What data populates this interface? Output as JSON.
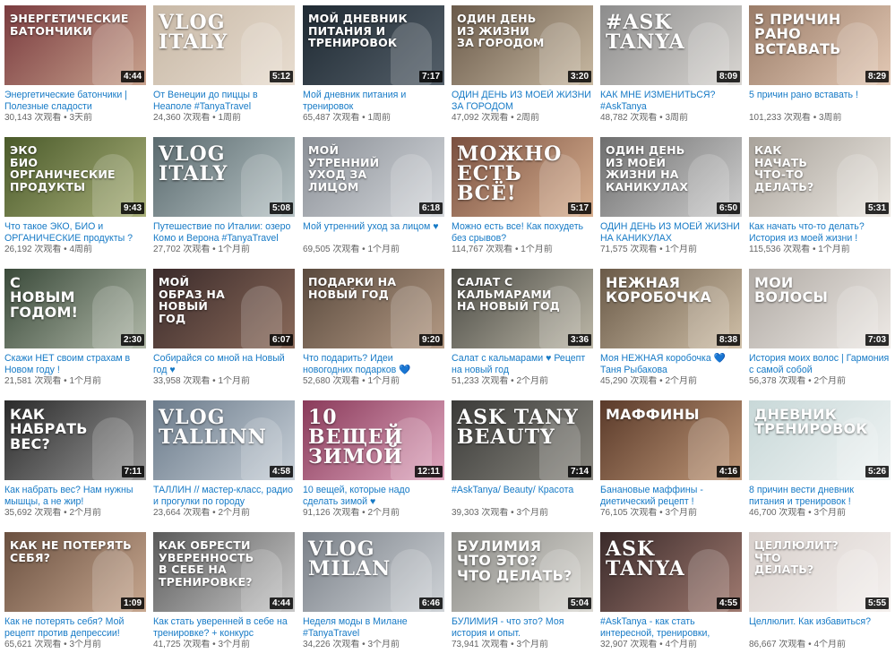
{
  "videos": [
    {
      "title": "Энергетические батончики | Полезные сладости",
      "views": "30,143 次观看",
      "age": "3天前",
      "duration": "4:44",
      "thumb_text": "ЭНЕРГЕТИЧЕСКИЕ\nБАТОНЧИКИ",
      "bg": [
        "#7a3b3f",
        "#c9a38e"
      ]
    },
    {
      "title": "От Венеции до пиццы в Неаполе #TanyaTravel",
      "views": "24,360 次观看",
      "age": "1周前",
      "duration": "5:12",
      "thumb_text": "VLOG\nITALY",
      "bg": [
        "#c7b8a6",
        "#e8ddd0"
      ]
    },
    {
      "title": "Мой дневник питания и тренировок",
      "views": "65,487 次观看",
      "age": "1周前",
      "duration": "7:17",
      "thumb_text": "МОЙ ДНЕВНИК\nПИТАНИЯ И\nТРЕНИРОВОК",
      "bg": [
        "#1f2a33",
        "#55606a"
      ]
    },
    {
      "title": "ОДИН ДЕНЬ ИЗ МОЕЙ ЖИЗНИ ЗА ГОРОДОМ",
      "views": "47,092 次观看",
      "age": "2周前",
      "duration": "3:20",
      "thumb_text": "ОДИН ДЕНЬ\nИЗ ЖИЗНИ\nЗА ГОРОДОМ",
      "bg": [
        "#6a5a4a",
        "#c8b9a2"
      ]
    },
    {
      "title": "КАК МНЕ ИЗМЕНИТЬСЯ? #AskTanya",
      "views": "48,782 次观看",
      "age": "3周前",
      "duration": "8:09",
      "thumb_text": "#ASK\nTANYA",
      "bg": [
        "#8c8c8c",
        "#d9d6d2"
      ]
    },
    {
      "title": "5 причин рано вставать !",
      "views": "101,233 次观看",
      "age": "3周前",
      "duration": "8:29",
      "thumb_text": "5 ПРИЧИН\nРАНО ВСТАВАТЬ",
      "bg": [
        "#9a7c68",
        "#e3c9b5"
      ]
    },
    {
      "title": "Что такое ЭКО, БИО и ОРГАНИЧЕСКИЕ продукты ?",
      "views": "26,192 次观看",
      "age": "4周前",
      "duration": "9:43",
      "thumb_text": "ЭКО\nБИО\nОРГАНИЧЕСКИЕ\nПРОДУКТЫ",
      "bg": [
        "#4a5a2a",
        "#a9b07a"
      ]
    },
    {
      "title": "Путешествие по Италии: озеро Комо и Верона #TanyaTravel",
      "views": "27,702 次观看",
      "age": "1个月前",
      "duration": "5:08",
      "thumb_text": "VLOG\nITALY",
      "bg": [
        "#5a6a6e",
        "#b8c4c6"
      ]
    },
    {
      "title": "Мой утренний уход за лицом ♥",
      "views": "69,505 次观看",
      "age": "1个月前",
      "duration": "6:18",
      "thumb_text": "МОЙ\nУТРЕННИЙ\nУХОД ЗА\nЛИЦОМ",
      "bg": [
        "#8a8f96",
        "#d5d8dc"
      ]
    },
    {
      "title": "Можно есть все! Как похудеть без срывов?",
      "views": "114,767 次观看",
      "age": "1个月前",
      "duration": "5:17",
      "thumb_text": "МОЖНО\nЕСТЬ\nВСЁ!",
      "bg": [
        "#7a5040",
        "#d8b090"
      ]
    },
    {
      "title": "ОДИН ДЕНЬ ИЗ МОЕЙ ЖИЗНИ НА КАНИКУЛАХ",
      "views": "71,575 次观看",
      "age": "1个月前",
      "duration": "6:50",
      "thumb_text": "ОДИН ДЕНЬ\nИЗ МОЕЙ\nЖИЗНИ НА\nКАНИКУЛАХ",
      "bg": [
        "#6e6e6e",
        "#cfcfcf"
      ]
    },
    {
      "title": "Как начать что-то делать? История из моей жизни !",
      "views": "115,536 次观看",
      "age": "1个月前",
      "duration": "5:31",
      "thumb_text": "КАК\nНАЧАТЬ\nЧТО-ТО\nДЕЛАТЬ?",
      "bg": [
        "#a8a29a",
        "#ece8e2"
      ]
    },
    {
      "title": "Скажи НЕТ своим страхам в Новом году !",
      "views": "21,581 次观看",
      "age": "1个月前",
      "duration": "2:30",
      "thumb_text": "С\nНОВЫМ\nГОДОМ!",
      "bg": [
        "#3a4a3a",
        "#b0b8a8"
      ]
    },
    {
      "title": "Собирайся со мной на Новый год ♥",
      "views": "33,958 次观看",
      "age": "1个月前",
      "duration": "6:07",
      "thumb_text": "МОЙ\nОБРАЗ НА\nНОВЫЙ\nГОД",
      "bg": [
        "#3a2a2a",
        "#8a6a5a"
      ]
    },
    {
      "title": "Что подарить? Идеи новогодних подарков 💙",
      "views": "52,680 次观看",
      "age": "1个月前",
      "duration": "9:20",
      "thumb_text": "ПОДАРКИ НА\nНОВЫЙ ГОД",
      "bg": [
        "#5a4a3e",
        "#b49a84"
      ]
    },
    {
      "title": "Салат с кальмарами ♥ Рецепт на новый год",
      "views": "51,233 次观看",
      "age": "2个月前",
      "duration": "3:36",
      "thumb_text": "САЛАТ С КАЛЬМАРАМИ\nНА НОВЫЙ ГОД",
      "bg": [
        "#4a4a44",
        "#bdb8a8"
      ]
    },
    {
      "title": "Моя НЕЖНАЯ коробочка 💙 Таня Рыбакова",
      "views": "45,290 次观看",
      "age": "2个月前",
      "duration": "8:38",
      "thumb_text": "НЕЖНАЯ\nКОРОБОЧКА",
      "bg": [
        "#6a5a48",
        "#d0c0a8"
      ]
    },
    {
      "title": "История моих волос | Гармония с самой собой",
      "views": "56,378 次观看",
      "age": "2个月前",
      "duration": "7:03",
      "thumb_text": "МОИ\nВОЛОСЫ",
      "bg": [
        "#b0aaa4",
        "#eeeae6"
      ]
    },
    {
      "title": "Как набрать вес? Нам нужны мышцы, а не жир!",
      "views": "35,692 次观看",
      "age": "2个月前",
      "duration": "7:11",
      "thumb_text": "КАК\nНАБРАТЬ\nВЕС?",
      "bg": [
        "#2a2a2a",
        "#9a9a9a"
      ]
    },
    {
      "title": "ТАЛЛИН // мастер-класс, радио и прогулки по городу",
      "views": "23,664 次观看",
      "age": "2个月前",
      "duration": "4:58",
      "thumb_text": "VLOG\nTALLINN",
      "bg": [
        "#6a7a8a",
        "#c8d0d8"
      ]
    },
    {
      "title": "10 вещей, которые надо сделать зимой ♥",
      "views": "91,126 次观看",
      "age": "2个月前",
      "duration": "12:11",
      "thumb_text": "10\nВЕЩЕЙ\nЗИМОЙ",
      "bg": [
        "#8a3a5a",
        "#e0a8c0"
      ]
    },
    {
      "title": "#AskTanya/ Beauty/ Красота",
      "views": "39,303 次观看",
      "age": "3个月前",
      "duration": "7:14",
      "thumb_text": "ASK TANY\nbeauty",
      "bg": [
        "#3a3a38",
        "#8a8880"
      ]
    },
    {
      "title": "Банановые маффины - диетический рецепт !",
      "views": "76,105 次观看",
      "age": "3个月前",
      "duration": "4:16",
      "thumb_text": "маффины",
      "bg": [
        "#5a3a2a",
        "#c09878"
      ]
    },
    {
      "title": "8 причин вести дневник питания и тренировок !",
      "views": "46,700 次观看",
      "age": "3个月前",
      "duration": "5:26",
      "thumb_text": "ДНЕВНИК\nТРЕНИРОВОК",
      "bg": [
        "#c8d8d8",
        "#f0f4f4"
      ]
    },
    {
      "title": "Как не потерять себя? Мой рецепт против депрессии!",
      "views": "65,621 次观看",
      "age": "3个月前",
      "duration": "1:09",
      "thumb_text": "КАК НЕ ПОТЕРЯТЬ\nСЕБЯ?",
      "bg": [
        "#6a5040",
        "#c8a890"
      ]
    },
    {
      "title": "Как стать уверенней в себе на тренировке? + конкурс",
      "views": "41,725 次观看",
      "age": "3个月前",
      "duration": "4:44",
      "thumb_text": "КАК ОБРЕСТИ\nУВЕРЕННОСТЬ\nВ СЕБЕ НА\nТРЕНИРОВКЕ?",
      "bg": [
        "#5a5a5a",
        "#c8c8c8"
      ]
    },
    {
      "title": "Неделя моды в Милане #TanyaTravel",
      "views": "34,226 次观看",
      "age": "3个月前",
      "duration": "6:46",
      "thumb_text": "VLOG\nMILAN",
      "bg": [
        "#7a8088",
        "#d0d4d8"
      ]
    },
    {
      "title": "БУЛИМИЯ - что это? Моя история и опыт.",
      "views": "73,941 次观看",
      "age": "3个月前",
      "duration": "5:04",
      "thumb_text": "БУЛИМИЯ\nЧТО ЭТО?\nЧТО ДЕЛАТЬ?",
      "bg": [
        "#8a8a86",
        "#dcdad4"
      ]
    },
    {
      "title": "#AskTanya - как стать интересной, тренировки,",
      "views": "32,907 次观看",
      "age": "4个月前",
      "duration": "4:55",
      "thumb_text": "ASK\nTANYA",
      "bg": [
        "#3a2a2a",
        "#a07a70"
      ]
    },
    {
      "title": "Целлюлит. Как избавиться?",
      "views": "86,667 次观看",
      "age": "4个月前",
      "duration": "5:55",
      "thumb_text": "ЦЕЛЛЮЛИТ?\nЧТО\nДЕЛАТЬ?",
      "bg": [
        "#d8d0cc",
        "#f4f0ee"
      ]
    }
  ],
  "separator": " • ",
  "colors": {
    "title": "#167ac6",
    "meta": "#666666",
    "duration_bg": "#000000"
  }
}
